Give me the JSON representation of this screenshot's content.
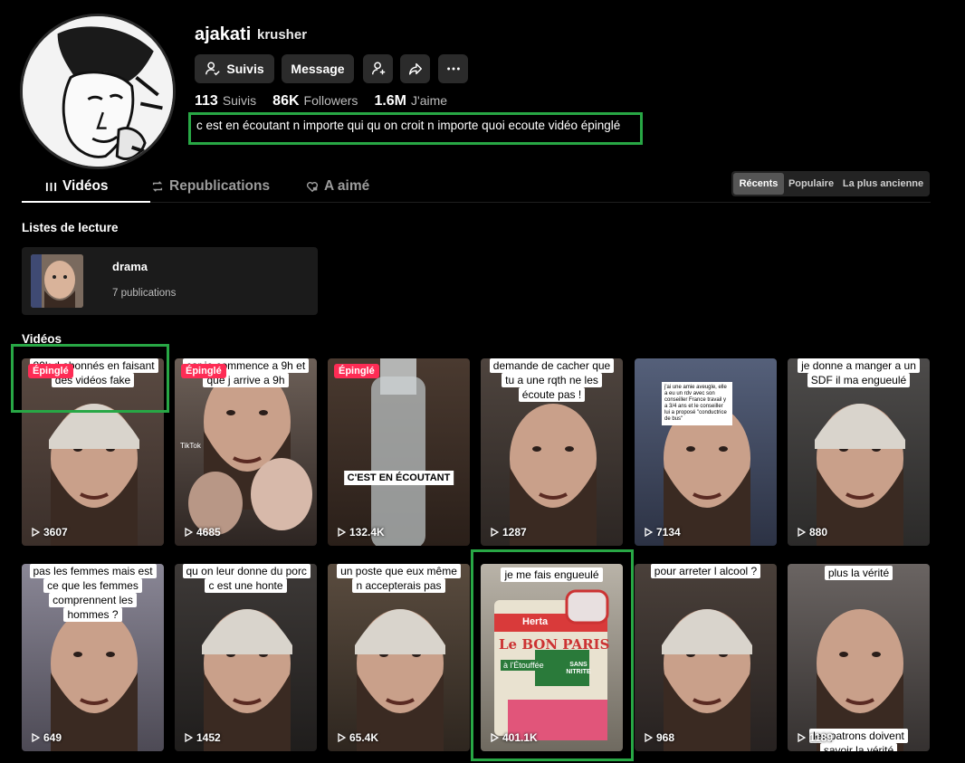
{
  "profile": {
    "username": "ajakati",
    "nickname": "krusher",
    "bio": "c est en écoutant n importe qui qu on croit n importe quoi ecoute vidéo épinglé"
  },
  "actions": {
    "follow_label": "Suivis",
    "message_label": "Message"
  },
  "stats": {
    "following_count": "113",
    "following_label": "Suivis",
    "followers_count": "86K",
    "followers_label": "Followers",
    "likes_count": "1.6M",
    "likes_label": "J'aime"
  },
  "tabs": [
    {
      "label": "Vidéos",
      "active": true
    },
    {
      "label": "Republications",
      "active": false
    },
    {
      "label": "A aimé",
      "active": false
    }
  ],
  "sort": {
    "options": [
      "Récents",
      "Populaire",
      "La plus ancienne"
    ],
    "selected": "Récents"
  },
  "playlists": {
    "heading": "Listes de lecture",
    "items": [
      {
        "name": "drama",
        "count": "7 publications"
      }
    ]
  },
  "videos": {
    "heading": "Vidéos",
    "pinned_label": "Épinglé",
    "items": [
      {
        "views": "3607",
        "pinned": true,
        "caption": "80k d abonnés en faisant des vidéos fake"
      },
      {
        "views": "4685",
        "pinned": true,
        "caption": "car je commence a 9h et que j arrive a 9h"
      },
      {
        "views": "132.4K",
        "pinned": true,
        "caption": "C'EST EN ÉCOUTANT"
      },
      {
        "views": "1287",
        "pinned": false,
        "caption": "demande de cacher que tu a une rqth ne les écoute pas !"
      },
      {
        "views": "7134",
        "pinned": false,
        "caption": "j'ai une amie aveugle, elle a eu un rdv avec son conseiller France travail y a 3/4 ans et le conseiller lui a proposé \"conductrice de bus\""
      },
      {
        "views": "880",
        "pinned": false,
        "caption": "je donne a manger a un SDF il ma engueulé"
      },
      {
        "views": "649",
        "pinned": false,
        "caption": "pas les femmes mais est ce que les femmes comprennent les hommes ?"
      },
      {
        "views": "1452",
        "pinned": false,
        "caption": "qu on leur donne du porc c est une honte"
      },
      {
        "views": "65.4K",
        "pinned": false,
        "caption": "un poste que eux même n accepterais pas"
      },
      {
        "views": "401.1K",
        "pinned": false,
        "caption": "je me fais engueulé"
      },
      {
        "views": "968",
        "pinned": false,
        "caption": "pour arreter l alcool ?"
      },
      {
        "views": "1189",
        "pinned": false,
        "caption": "plus la vérité"
      }
    ],
    "extra_captions": {
      "tile_11_bottom": "les patrons doivent savoir la vérité",
      "tile_10_label_1": "Herta",
      "tile_10_label_2": "Le BON PARIS",
      "tile_10_label_3": "à l'Étouffée",
      "tile_10_label_4": "SANS NITRITE",
      "tile_2_watermark": "TikTok"
    }
  },
  "icons": {
    "follow_button": "user-check-icon",
    "add_friend": "user-plus-icon",
    "share": "share-arrow-icon",
    "more": "more-dots-icon",
    "videos_tab": "grid-bars-icon",
    "reposts_tab": "repost-icon",
    "liked_tab": "heart-lock-icon",
    "views": "play-icon"
  },
  "colors": {
    "background": "#000000",
    "button": "#2b2b2b",
    "pinned_badge": "#fe2c55",
    "highlight_box": "#28a745"
  }
}
